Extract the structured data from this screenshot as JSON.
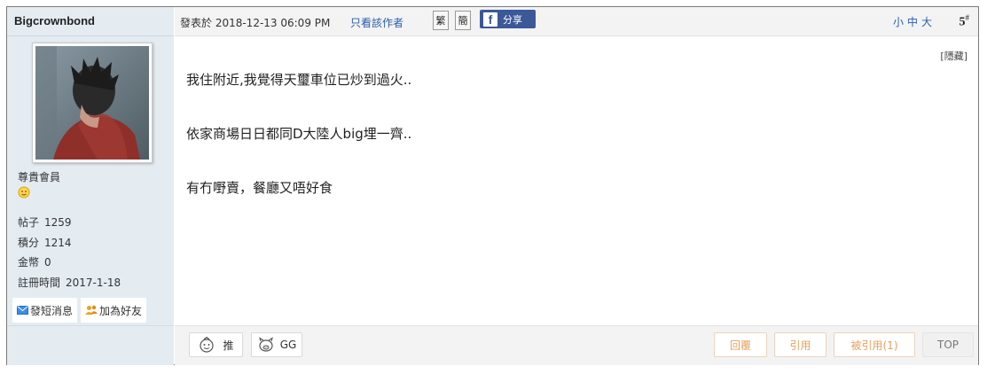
{
  "author": {
    "name": "Bigcrownbond",
    "rank": "尊貴會員",
    "stats": [
      {
        "label": "帖子",
        "value": "1259"
      },
      {
        "label": "積分",
        "value": "1214"
      },
      {
        "label": "金幣",
        "value": "0"
      },
      {
        "label": "註冊時間",
        "value": "2017-1-18"
      }
    ],
    "actions": {
      "message": "發短消息",
      "add_friend": "加為好友"
    }
  },
  "post": {
    "posted_at": "發表於 2018-12-13 06:09 PM",
    "only_author": "只看該作者",
    "trad": "繁",
    "simp": "簡",
    "share": "分享",
    "font_sizes": "小中大",
    "floor": "5",
    "floor_suffix": "#",
    "hide": "[隱藏]",
    "lines": [
      "我住附近,我覺得天璽車位已炒到過火..",
      "依家商場日日都同D大陸人big埋一齊..",
      "有冇嘢賣，餐廳又唔好食"
    ]
  },
  "footer": {
    "push": "推",
    "gg": "GG",
    "reply": "回覆",
    "quote": "引用",
    "quoted": "被引用(1)",
    "top": "TOP"
  },
  "colors": {
    "sidebar_bg": "#e4ecf2",
    "link": "#2a5db0",
    "facebook": "#3b5998",
    "button_accent": "#e8a05c"
  }
}
